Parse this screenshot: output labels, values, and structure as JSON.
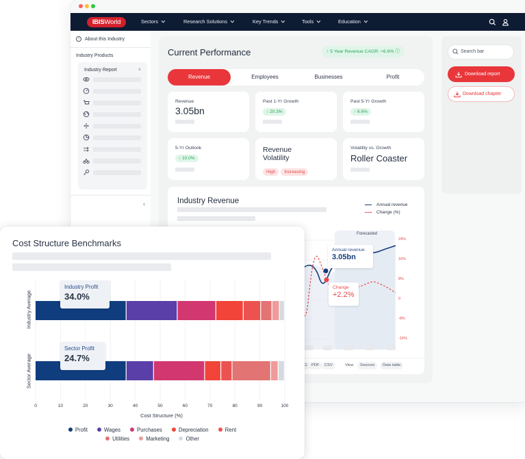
{
  "window": {
    "traffic_lights": [
      "#fe5f57",
      "#febc2e",
      "#28c840"
    ]
  },
  "navbar": {
    "logo_bold": "IBIS",
    "logo_rest": "World",
    "items": [
      {
        "label": "Sectors"
      },
      {
        "label": "Research Solutions"
      },
      {
        "label": "Key Trends"
      },
      {
        "label": "Tools"
      },
      {
        "label": "Education"
      }
    ],
    "icons": [
      "search-icon",
      "user-icon"
    ]
  },
  "sidebar": {
    "about_label": "About this Industry",
    "products_label": "Industry Products",
    "report_label": "Industry Report",
    "report_items": [
      {
        "icon": "eye-icon"
      },
      {
        "icon": "gauge-icon"
      },
      {
        "icon": "cart-icon"
      },
      {
        "icon": "globe-icon"
      },
      {
        "icon": "compare-icon"
      },
      {
        "icon": "pie-chart-icon"
      },
      {
        "icon": "arrows-icon"
      },
      {
        "icon": "scale-icon"
      },
      {
        "icon": "key-icon"
      }
    ],
    "collapse_glyph": "‹"
  },
  "main": {
    "title": "Current Performance",
    "cagr_badge": "↑ 5 Year Revenue CAGR: +6.6% ⓘ",
    "tabs": [
      {
        "label": "Revenue",
        "active": true
      },
      {
        "label": "Employees",
        "active": false
      },
      {
        "label": "Businesses",
        "active": false
      },
      {
        "label": "Profit",
        "active": false
      }
    ],
    "cards": {
      "revenue": {
        "label": "Revenue",
        "value": "3.05bn"
      },
      "past_1yr": {
        "label": "Past 1-Yr Growth",
        "value": "↑ 20.3%"
      },
      "past_5yr": {
        "label": "Past 5-Yr Growth",
        "value": "↑ 6.6%"
      },
      "outlook": {
        "label": "5-Yr Outlook",
        "value": "↑ 10.0%"
      },
      "volatility": {
        "title_line1": "Revenue",
        "title_line2": "Volatility",
        "tags": [
          "High",
          "Increasing"
        ]
      },
      "vol_vs_growth": {
        "label": "Volatility vs. Growth",
        "value": "Roller Coaster"
      }
    }
  },
  "revenue_chart": {
    "title": "Industry Revenue",
    "legend": [
      {
        "label": "Annual revenue",
        "style": "solid",
        "color": "#153d7a"
      },
      {
        "label": "Change (%)",
        "style": "dashed",
        "color": "#e84848"
      }
    ],
    "forecast_label": "Forecasted",
    "right_axis_ticks": [
      "24%",
      "16%",
      "8%",
      "0",
      "-8%",
      "-16%"
    ],
    "right_axis_range": [
      -16,
      24
    ],
    "tooltip_revenue": {
      "label": "Annual revenue",
      "value": "3.05bn"
    },
    "tooltip_change": {
      "label": "Change",
      "value": "+2.2%"
    },
    "change_series_visible": [
      -10,
      22,
      2.2,
      -1,
      5,
      8,
      3
    ],
    "footer_buttons": [
      "PNG",
      "PDF",
      "CSV",
      "View",
      "Sources",
      "Data table"
    ]
  },
  "right_panel": {
    "search_placeholder": "Search bar",
    "download_report": "Download report",
    "download_chapter": "Download chapter"
  },
  "chart_data": {
    "type": "bar",
    "orientation": "horizontal-stacked",
    "title": "Cost Structure Benchmarks",
    "xlabel": "Cost Structure (%)",
    "ylabel": "",
    "xlim": [
      0,
      100
    ],
    "x_ticks": [
      0,
      10,
      20,
      30,
      40,
      50,
      60,
      70,
      80,
      90,
      100
    ],
    "grid": true,
    "legend_position": "bottom",
    "categories": [
      "Industry Average",
      "Sector Average"
    ],
    "series": [
      {
        "name": "Profit",
        "color": "#0f3d7e",
        "values": [
          36.5,
          36.5
        ]
      },
      {
        "name": "Wages",
        "color": "#5a3fa8",
        "values": [
          20.5,
          11
        ]
      },
      {
        "name": "Purchases",
        "color": "#d3376f",
        "values": [
          15.5,
          20.5
        ]
      },
      {
        "name": "Depreciation",
        "color": "#f24438",
        "values": [
          11,
          6.5
        ]
      },
      {
        "name": "Rent",
        "color": "#ec5350",
        "values": [
          7,
          4.5
        ]
      },
      {
        "name": "Utilities",
        "color": "#e27473",
        "values": [
          4.5,
          15.5
        ]
      },
      {
        "name": "Marketing",
        "color": "#ef9b9b",
        "values": [
          3,
          3
        ]
      },
      {
        "name": "Other",
        "color": "#d4dae0",
        "values": [
          2,
          2.5
        ]
      }
    ],
    "annotations": [
      {
        "category": "Industry Average",
        "label": "Industry Profit",
        "value": "34.0%"
      },
      {
        "category": "Sector Average",
        "label": "Sector Profit",
        "value": "24.7%"
      }
    ]
  }
}
